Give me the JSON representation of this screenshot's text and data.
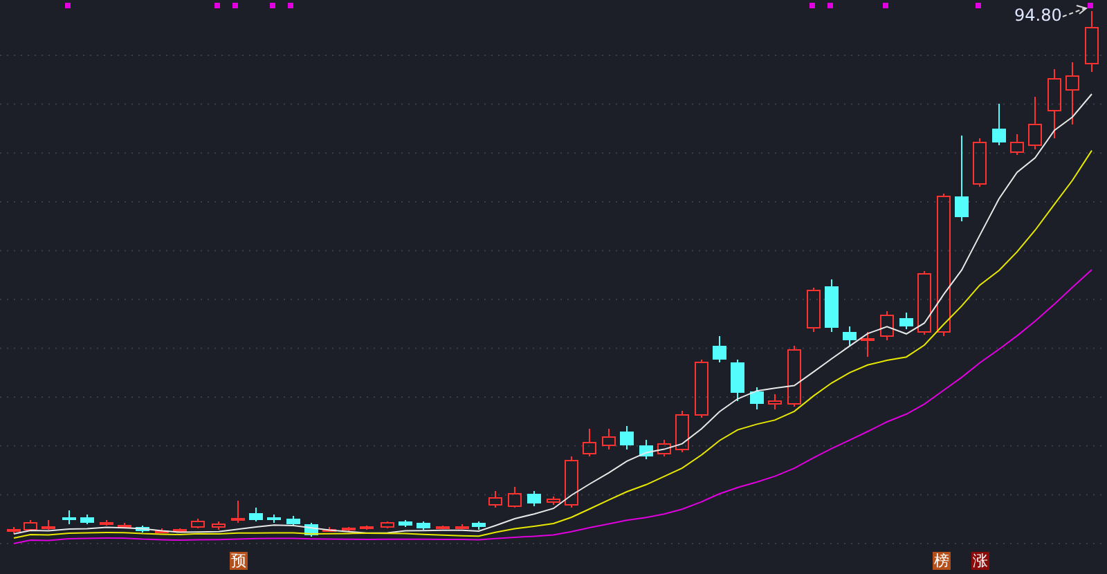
{
  "chart": {
    "price_label": "94.80",
    "markers": [
      {
        "label": "预",
        "color": "#b5501a"
      },
      {
        "label": "榜",
        "color": "#b5501a"
      },
      {
        "label": "涨",
        "color": "#8b0a0a"
      }
    ]
  }
}
